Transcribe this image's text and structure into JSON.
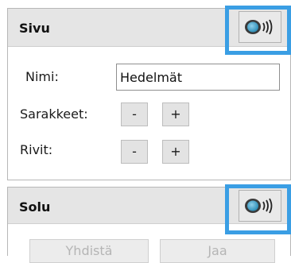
{
  "sections": {
    "page": {
      "title": "Sivu",
      "speak_icon": "speaker-icon",
      "name_label": "Nimi:",
      "name_value": "Hedelmät",
      "columns_label": "Sarakkeet:",
      "rows_label": "Rivit:",
      "decrease_label": "-",
      "increase_label": "+"
    },
    "cell": {
      "title": "Solu",
      "speak_icon": "speaker-icon",
      "merge_label": "Yhdistä",
      "split_label": "Jaa"
    }
  },
  "colors": {
    "highlight": "#3a9ee4",
    "header_bg": "#e5e5e5",
    "icon_blue": "#49a7cf"
  }
}
